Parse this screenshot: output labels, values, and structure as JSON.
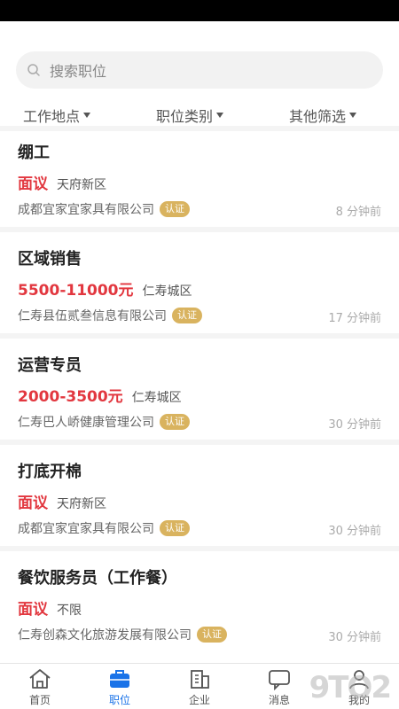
{
  "search": {
    "placeholder": "搜索职位"
  },
  "filters": [
    {
      "label": "工作地点"
    },
    {
      "label": "职位类别"
    },
    {
      "label": "其他筛选"
    }
  ],
  "jobs": [
    {
      "title": "绷工",
      "salary": "面议",
      "location": "天府新区",
      "company": "成都宜家宜家具有限公司",
      "badge": "认证",
      "time": "8 分钟前"
    },
    {
      "title": "区域销售",
      "salary": "5500-11000元",
      "location": "仁寿城区",
      "company": "仁寿县伍贰叁信息有限公司",
      "badge": "认证",
      "time": "17 分钟前"
    },
    {
      "title": "运营专员",
      "salary": "2000-3500元",
      "location": "仁寿城区",
      "company": "仁寿巴人峤健康管理公司",
      "badge": "认证",
      "time": "30 分钟前"
    },
    {
      "title": "打底开棉",
      "salary": "面议",
      "location": "天府新区",
      "company": "成都宜家宜家具有限公司",
      "badge": "认证",
      "time": "30 分钟前"
    },
    {
      "title": "餐饮服务员（工作餐）",
      "salary": "面议",
      "location": "不限",
      "company": "仁寿创森文化旅游发展有限公司",
      "badge": "认证",
      "time": "30 分钟前"
    }
  ],
  "tabbar": [
    {
      "label": "首页",
      "icon": "home-icon"
    },
    {
      "label": "职位",
      "icon": "briefcase-icon",
      "active": true
    },
    {
      "label": "企业",
      "icon": "building-icon"
    },
    {
      "label": "消息",
      "icon": "message-icon"
    },
    {
      "label": "我的",
      "icon": "user-icon"
    }
  ],
  "watermark": "9ТО2",
  "colors": {
    "accent": "#1a73e8",
    "salary": "#e2373f",
    "badge": "#d9b35f"
  }
}
